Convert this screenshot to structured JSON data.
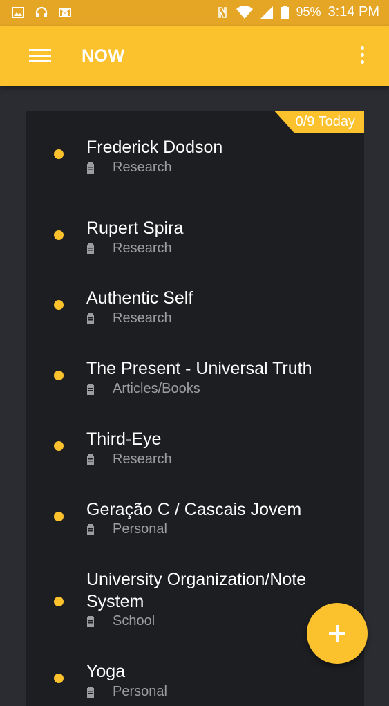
{
  "status_bar": {
    "battery": "95%",
    "time": "3:14 PM",
    "icons": [
      "image-icon",
      "headset-icon",
      "gmail-icon",
      "nfc-icon",
      "wifi-icon",
      "signal-icon",
      "battery-icon"
    ]
  },
  "app_bar": {
    "title": "NOW",
    "menu_icon": "hamburger-menu-icon",
    "overflow_icon": "more-vert-icon"
  },
  "counter_badge": "0/9 Today",
  "tasks": [
    {
      "title": "Frederick Dodson",
      "category": "Research"
    },
    {
      "title": "Rupert Spira",
      "category": "Research"
    },
    {
      "title": "Authentic Self",
      "category": "Research"
    },
    {
      "title": "The Present - Universal Truth",
      "category": "Articles/Books"
    },
    {
      "title": "Third-Eye",
      "category": "Research"
    },
    {
      "title": "Geração C / Cascais Jovem",
      "category": "Personal"
    },
    {
      "title": "University Organization/Note System",
      "category": "School"
    },
    {
      "title": "Yoga",
      "category": "Personal"
    }
  ],
  "fab_icon": "add-icon",
  "colors": {
    "accent": "#fcc22d",
    "status_bar": "#e5a626",
    "background": "#2b2c31",
    "card": "#1d1e22"
  }
}
